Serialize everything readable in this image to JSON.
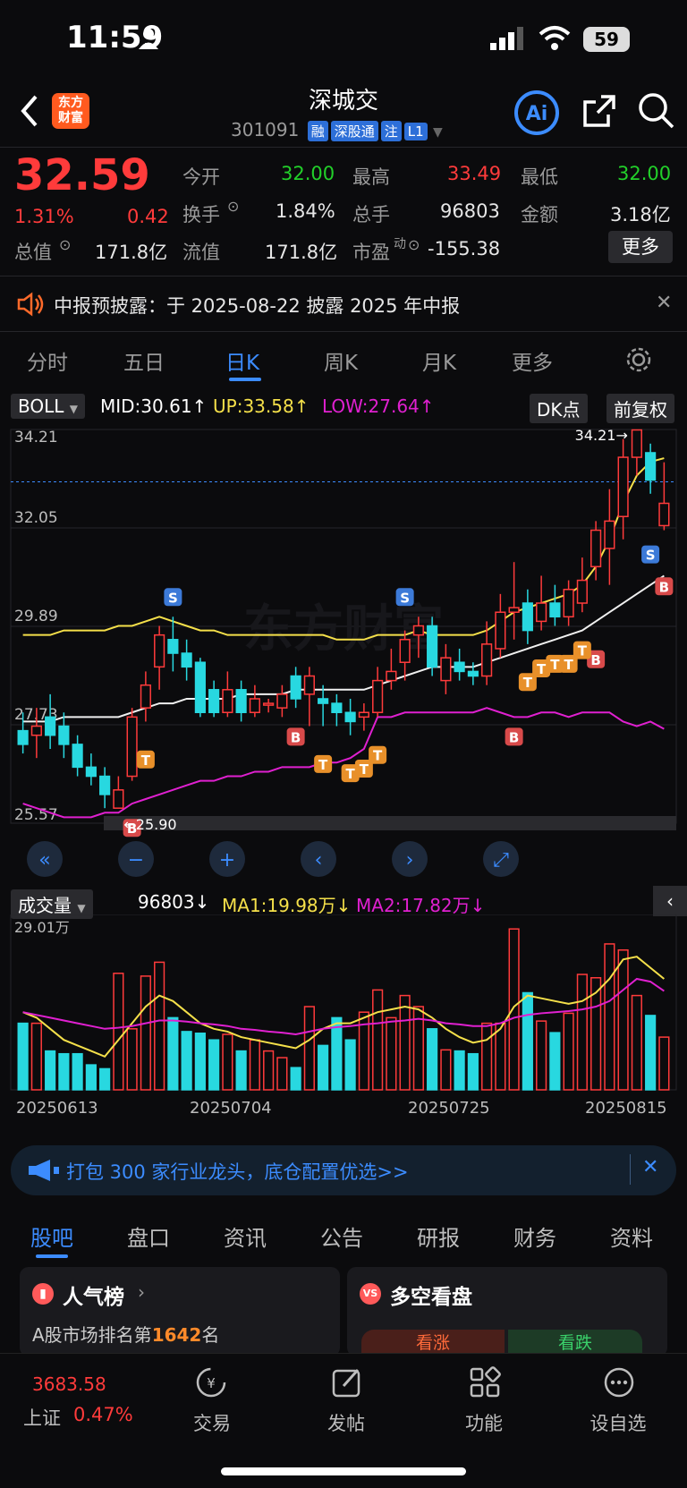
{
  "status_bar": {
    "time": "11:59",
    "battery": "59"
  },
  "header": {
    "title": "深城交",
    "code": "301091",
    "tags": [
      "融",
      "深股通",
      "注",
      "L1"
    ],
    "logo_text": "东方\n财富",
    "icons": [
      "back-icon",
      "ai-icon",
      "share-icon",
      "search-icon"
    ]
  },
  "quote": {
    "price": "32.59",
    "change_pct": "1.31%",
    "change": "0.42",
    "open_label": "今开",
    "open": "32.00",
    "high_label": "最高",
    "high": "33.49",
    "low_label": "最低",
    "low": "32.00",
    "turnover_label": "换手",
    "turnover": "1.84%",
    "volume_label": "总手",
    "volume": "96803",
    "amount_label": "金额",
    "amount": "3.18亿",
    "mktcap_label": "总值",
    "mktcap": "171.8亿",
    "float_label": "流值",
    "float": "171.8亿",
    "pe_label": "市盈",
    "pe_sup": "动",
    "pe": "-155.38",
    "more": "更多"
  },
  "notice": {
    "text": "中报预披露：于 2025-08-22 披露 2025 年中报"
  },
  "chart_tabs": [
    "分时",
    "五日",
    "日K",
    "周K",
    "月K",
    "更多"
  ],
  "active_tab": "日K",
  "indicator": {
    "name": "BOLL",
    "mid": "MID:30.61↑",
    "up": "UP:33.58↑",
    "low": "LOW:27.64↑",
    "dk": "DK点",
    "adj": "前复权"
  },
  "colors": {
    "up": "#ff3b3b",
    "down": "#28d8e0",
    "ma_yellow": "#f5e04a",
    "ma_white": "#f0f0f0",
    "boll_low": "#e020d0",
    "accent": "#3c8cff"
  },
  "chart_data": [
    {
      "type": "candlestick",
      "price_axis_labels": [
        "34.21",
        "32.05",
        "29.89",
        "27.73",
        "25.57"
      ],
      "ylim": [
        25.57,
        34.21
      ],
      "high_marker": "34.21",
      "low_marker": "25.90",
      "x_labels": [
        "20250613",
        "20250704",
        "20250725",
        "20250815"
      ],
      "candles": [
        {
          "o": 27.6,
          "c": 27.3,
          "h": 28.0,
          "l": 27.1
        },
        {
          "o": 27.5,
          "c": 27.7,
          "h": 28.1,
          "l": 27.0
        },
        {
          "o": 27.9,
          "c": 27.5,
          "h": 28.4,
          "l": 27.2
        },
        {
          "o": 27.7,
          "c": 27.3,
          "h": 28.0,
          "l": 27.0
        },
        {
          "o": 27.3,
          "c": 26.8,
          "h": 27.5,
          "l": 26.6
        },
        {
          "o": 26.8,
          "c": 26.6,
          "h": 27.1,
          "l": 26.4
        },
        {
          "o": 26.6,
          "c": 26.2,
          "h": 26.8,
          "l": 25.9
        },
        {
          "o": 25.9,
          "c": 26.3,
          "h": 26.6,
          "l": 25.9
        },
        {
          "o": 26.6,
          "c": 27.9,
          "h": 28.1,
          "l": 26.5
        },
        {
          "o": 28.1,
          "c": 28.6,
          "h": 28.9,
          "l": 27.8
        },
        {
          "o": 29.0,
          "c": 29.7,
          "h": 29.9,
          "l": 28.5
        },
        {
          "o": 29.6,
          "c": 29.3,
          "h": 30.1,
          "l": 28.9
        },
        {
          "o": 29.3,
          "c": 29.0,
          "h": 29.6,
          "l": 28.7
        },
        {
          "o": 29.1,
          "c": 28.0,
          "h": 29.2,
          "l": 27.9
        },
        {
          "o": 28.5,
          "c": 28.0,
          "h": 28.7,
          "l": 27.9
        },
        {
          "o": 28.0,
          "c": 28.5,
          "h": 28.9,
          "l": 27.9
        },
        {
          "o": 28.5,
          "c": 28.0,
          "h": 28.7,
          "l": 27.8
        },
        {
          "o": 28.0,
          "c": 28.3,
          "h": 28.6,
          "l": 27.9
        },
        {
          "o": 28.2,
          "c": 28.2,
          "h": 28.3,
          "l": 28.0
        },
        {
          "o": 28.1,
          "c": 28.4,
          "h": 28.6,
          "l": 27.9
        },
        {
          "o": 28.8,
          "c": 28.3,
          "h": 29.0,
          "l": 28.1
        },
        {
          "o": 28.4,
          "c": 28.8,
          "h": 29.0,
          "l": 27.7
        },
        {
          "o": 28.3,
          "c": 28.2,
          "h": 28.6,
          "l": 27.7
        },
        {
          "o": 28.2,
          "c": 28.0,
          "h": 28.4,
          "l": 27.7
        },
        {
          "o": 28.0,
          "c": 27.8,
          "h": 28.3,
          "l": 27.5
        },
        {
          "o": 27.9,
          "c": 28.0,
          "h": 28.2,
          "l": 27.6
        },
        {
          "o": 28.0,
          "c": 28.7,
          "h": 29.0,
          "l": 27.9
        },
        {
          "o": 28.7,
          "c": 28.9,
          "h": 29.4,
          "l": 28.5
        },
        {
          "o": 29.1,
          "c": 29.6,
          "h": 29.8,
          "l": 28.7
        },
        {
          "o": 29.7,
          "c": 29.9,
          "h": 30.1,
          "l": 29.2
        },
        {
          "o": 29.9,
          "c": 29.0,
          "h": 30.1,
          "l": 28.8
        },
        {
          "o": 28.7,
          "c": 29.2,
          "h": 29.5,
          "l": 28.4
        },
        {
          "o": 29.1,
          "c": 28.9,
          "h": 29.4,
          "l": 28.7
        },
        {
          "o": 28.9,
          "c": 28.8,
          "h": 29.1,
          "l": 28.6
        },
        {
          "o": 28.8,
          "c": 29.5,
          "h": 30.0,
          "l": 28.6
        },
        {
          "o": 29.4,
          "c": 30.2,
          "h": 30.6,
          "l": 29.2
        },
        {
          "o": 30.2,
          "c": 30.3,
          "h": 31.3,
          "l": 29.6
        },
        {
          "o": 30.4,
          "c": 29.8,
          "h": 30.7,
          "l": 29.5
        },
        {
          "o": 30.0,
          "c": 30.4,
          "h": 31.0,
          "l": 29.8
        },
        {
          "o": 30.4,
          "c": 30.1,
          "h": 30.8,
          "l": 29.9
        },
        {
          "o": 30.1,
          "c": 30.7,
          "h": 30.9,
          "l": 29.9
        },
        {
          "o": 30.4,
          "c": 30.9,
          "h": 31.4,
          "l": 30.2
        },
        {
          "o": 31.2,
          "c": 32.0,
          "h": 32.2,
          "l": 30.9
        },
        {
          "o": 31.6,
          "c": 32.2,
          "h": 32.9,
          "l": 30.8
        },
        {
          "o": 32.3,
          "c": 33.6,
          "h": 34.0,
          "l": 31.8
        },
        {
          "o": 33.6,
          "c": 34.2,
          "h": 34.21,
          "l": 33.2
        },
        {
          "o": 33.7,
          "c": 33.1,
          "h": 33.9,
          "l": 32.8
        },
        {
          "o": 32.1,
          "c": 32.59,
          "h": 33.49,
          "l": 32.0
        }
      ],
      "ma_white": [
        27.8,
        27.8,
        27.8,
        27.9,
        27.9,
        27.9,
        27.9,
        27.9,
        28.0,
        28.1,
        28.2,
        28.2,
        28.3,
        28.3,
        28.3,
        28.3,
        28.4,
        28.4,
        28.4,
        28.4,
        28.5,
        28.5,
        28.5,
        28.5,
        28.5,
        28.5,
        28.6,
        28.7,
        28.8,
        28.9,
        29.0,
        29.0,
        29.0,
        29.0,
        29.1,
        29.2,
        29.3,
        29.4,
        29.5,
        29.6,
        29.7,
        29.8,
        30.0,
        30.2,
        30.4,
        30.6,
        30.8,
        31.0
      ],
      "ma_yellow": [
        29.7,
        29.7,
        29.7,
        29.8,
        29.8,
        29.8,
        29.8,
        29.9,
        29.9,
        30.0,
        30.1,
        30.0,
        29.9,
        29.8,
        29.8,
        29.7,
        29.7,
        29.7,
        29.7,
        29.7,
        29.7,
        29.7,
        29.7,
        29.6,
        29.6,
        29.6,
        29.7,
        29.7,
        29.7,
        29.8,
        29.7,
        29.7,
        29.7,
        29.7,
        29.8,
        30.0,
        30.2,
        30.3,
        30.4,
        30.5,
        30.6,
        30.8,
        31.2,
        31.8,
        32.6,
        33.2,
        33.5,
        33.58
      ],
      "boll_low": [
        26.0,
        25.9,
        25.8,
        25.7,
        25.7,
        25.7,
        25.8,
        25.8,
        26.0,
        26.1,
        26.2,
        26.3,
        26.4,
        26.5,
        26.5,
        26.6,
        26.6,
        26.7,
        26.7,
        26.8,
        26.8,
        26.8,
        26.9,
        26.9,
        27.0,
        27.2,
        27.9,
        27.9,
        28.0,
        28.0,
        28.0,
        28.0,
        28.0,
        28.0,
        28.1,
        28.0,
        27.9,
        27.9,
        28.0,
        28.0,
        27.9,
        28.0,
        28.0,
        28.0,
        27.8,
        27.7,
        27.8,
        27.64
      ]
    },
    {
      "type": "bar",
      "indicator": "成交量",
      "volume": "96803↓",
      "ma1": "MA1:19.98万↓",
      "ma2": "MA2:17.82万↓",
      "ymax_label": "29.01万",
      "values": [
        12,
        12,
        7,
        6.5,
        6.5,
        4.5,
        3.8,
        21,
        11,
        20.5,
        23,
        13,
        10.5,
        10.2,
        9,
        10,
        7,
        9,
        7,
        5.8,
        4,
        15,
        8,
        13,
        9,
        14,
        18,
        13,
        17,
        15,
        11,
        7.2,
        7,
        6.5,
        12,
        12,
        29,
        17.5,
        12.4,
        10.3,
        13.8,
        20.8,
        20.2,
        26.3,
        25.2,
        17,
        13.4,
        9.5
      ],
      "ma1_line": [
        14,
        13,
        11,
        9,
        8,
        7,
        6,
        9,
        12,
        15,
        17,
        16,
        14,
        12,
        11,
        10.5,
        9.5,
        9,
        8.5,
        8,
        7.5,
        9,
        11,
        12,
        12,
        13,
        14,
        14.5,
        15,
        14.5,
        13,
        11,
        9.5,
        8.5,
        9,
        11,
        15,
        17,
        16.5,
        16,
        15.5,
        16,
        17.5,
        20,
        23.5,
        24,
        22,
        20
      ],
      "ma2_line": [
        14,
        13.5,
        13,
        12.5,
        12,
        11.5,
        11,
        11.2,
        11.5,
        12,
        12.5,
        12.5,
        12.3,
        12,
        11.8,
        11.5,
        11,
        10.8,
        10.5,
        10.3,
        10,
        10.5,
        11,
        11.3,
        11.5,
        11.8,
        12,
        12.3,
        12.5,
        12.8,
        12.5,
        12,
        11.8,
        11.5,
        11.5,
        12,
        13,
        13.5,
        13.8,
        14,
        14.2,
        14.5,
        15,
        16,
        18,
        20,
        19.5,
        17.82
      ]
    }
  ],
  "volume_labels": {
    "name": "成交量",
    "volume": "96803↓",
    "ma1": "MA1:19.98万↓",
    "ma2": "MA2:17.82万↓",
    "ymax": "29.01万"
  },
  "ad_banner": {
    "text": "打包 300 家行业龙头，底仓配置优选>>"
  },
  "bottom_tabs": [
    "股吧",
    "盘口",
    "资讯",
    "公告",
    "研报",
    "财务",
    "资料"
  ],
  "cards": {
    "left_title": "人气榜",
    "left_sub_prefix": "A股市场排名第",
    "left_rank": "1642",
    "left_sub_suffix": "名",
    "right_title": "多空看盘",
    "right_up": "看涨",
    "right_down": "看跌"
  },
  "nav": {
    "index_value": "3683.58",
    "index_name": "上证",
    "index_change": "0.47%",
    "items": [
      "交易",
      "发帖",
      "功能",
      "设自选"
    ]
  }
}
